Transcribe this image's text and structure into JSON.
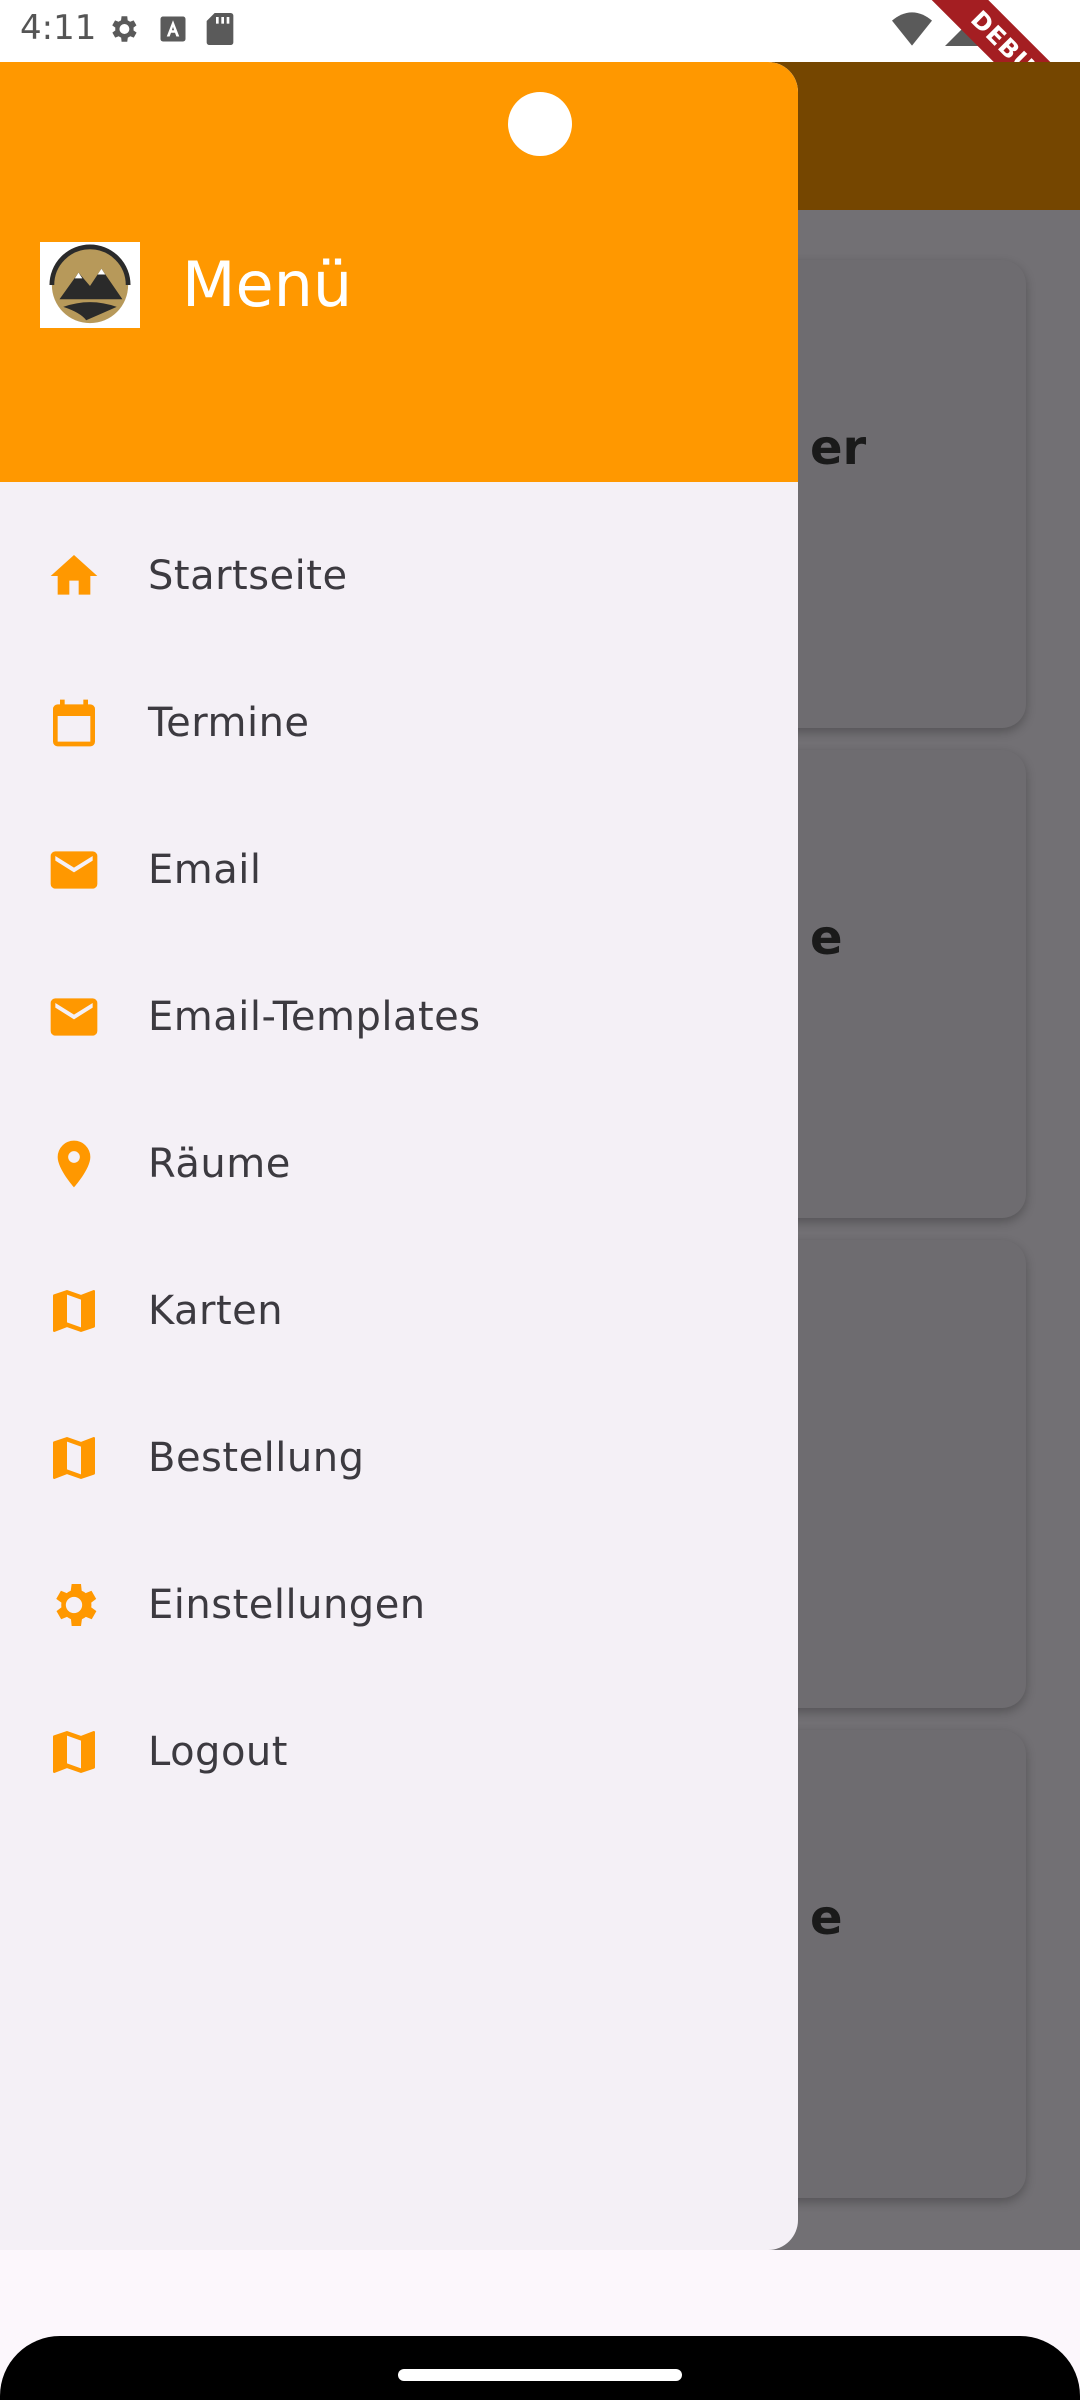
{
  "status_bar": {
    "time": "4:11",
    "left_icons": [
      "gear-icon",
      "text-icon",
      "sd-card-icon"
    ],
    "right_icons": [
      "wifi-icon",
      "signal-icon"
    ],
    "debug_label": "DEBUG"
  },
  "background": {
    "app_bar_color": "#754600",
    "cards": [
      {
        "fragment": "er"
      },
      {
        "fragment": "e"
      },
      {
        "fragment": ""
      },
      {
        "fragment": "e"
      }
    ]
  },
  "drawer": {
    "title": "Menü",
    "header_color": "#ff9800",
    "accent_color": "#ff9800",
    "items": [
      {
        "label": "Startseite",
        "icon": "home-icon"
      },
      {
        "label": "Termine",
        "icon": "calendar-icon"
      },
      {
        "label": "Email",
        "icon": "mail-icon"
      },
      {
        "label": "Email-Templates",
        "icon": "mail-icon"
      },
      {
        "label": "Räume",
        "icon": "location-pin-icon"
      },
      {
        "label": "Karten",
        "icon": "map-icon"
      },
      {
        "label": "Bestellung",
        "icon": "map-icon"
      },
      {
        "label": "Einstellungen",
        "icon": "gear-icon"
      },
      {
        "label": "Logout",
        "icon": "map-icon"
      }
    ]
  }
}
